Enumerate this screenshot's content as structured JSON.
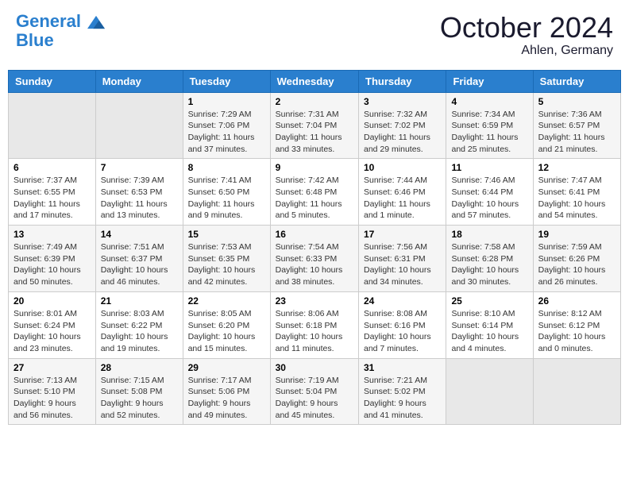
{
  "header": {
    "logo_line1": "General",
    "logo_line2": "Blue",
    "month": "October 2024",
    "location": "Ahlen, Germany"
  },
  "weekdays": [
    "Sunday",
    "Monday",
    "Tuesday",
    "Wednesday",
    "Thursday",
    "Friday",
    "Saturday"
  ],
  "weeks": [
    [
      {
        "day": "",
        "details": ""
      },
      {
        "day": "",
        "details": ""
      },
      {
        "day": "1",
        "details": "Sunrise: 7:29 AM\nSunset: 7:06 PM\nDaylight: 11 hours and 37 minutes."
      },
      {
        "day": "2",
        "details": "Sunrise: 7:31 AM\nSunset: 7:04 PM\nDaylight: 11 hours and 33 minutes."
      },
      {
        "day": "3",
        "details": "Sunrise: 7:32 AM\nSunset: 7:02 PM\nDaylight: 11 hours and 29 minutes."
      },
      {
        "day": "4",
        "details": "Sunrise: 7:34 AM\nSunset: 6:59 PM\nDaylight: 11 hours and 25 minutes."
      },
      {
        "day": "5",
        "details": "Sunrise: 7:36 AM\nSunset: 6:57 PM\nDaylight: 11 hours and 21 minutes."
      }
    ],
    [
      {
        "day": "6",
        "details": "Sunrise: 7:37 AM\nSunset: 6:55 PM\nDaylight: 11 hours and 17 minutes."
      },
      {
        "day": "7",
        "details": "Sunrise: 7:39 AM\nSunset: 6:53 PM\nDaylight: 11 hours and 13 minutes."
      },
      {
        "day": "8",
        "details": "Sunrise: 7:41 AM\nSunset: 6:50 PM\nDaylight: 11 hours and 9 minutes."
      },
      {
        "day": "9",
        "details": "Sunrise: 7:42 AM\nSunset: 6:48 PM\nDaylight: 11 hours and 5 minutes."
      },
      {
        "day": "10",
        "details": "Sunrise: 7:44 AM\nSunset: 6:46 PM\nDaylight: 11 hours and 1 minute."
      },
      {
        "day": "11",
        "details": "Sunrise: 7:46 AM\nSunset: 6:44 PM\nDaylight: 10 hours and 57 minutes."
      },
      {
        "day": "12",
        "details": "Sunrise: 7:47 AM\nSunset: 6:41 PM\nDaylight: 10 hours and 54 minutes."
      }
    ],
    [
      {
        "day": "13",
        "details": "Sunrise: 7:49 AM\nSunset: 6:39 PM\nDaylight: 10 hours and 50 minutes."
      },
      {
        "day": "14",
        "details": "Sunrise: 7:51 AM\nSunset: 6:37 PM\nDaylight: 10 hours and 46 minutes."
      },
      {
        "day": "15",
        "details": "Sunrise: 7:53 AM\nSunset: 6:35 PM\nDaylight: 10 hours and 42 minutes."
      },
      {
        "day": "16",
        "details": "Sunrise: 7:54 AM\nSunset: 6:33 PM\nDaylight: 10 hours and 38 minutes."
      },
      {
        "day": "17",
        "details": "Sunrise: 7:56 AM\nSunset: 6:31 PM\nDaylight: 10 hours and 34 minutes."
      },
      {
        "day": "18",
        "details": "Sunrise: 7:58 AM\nSunset: 6:28 PM\nDaylight: 10 hours and 30 minutes."
      },
      {
        "day": "19",
        "details": "Sunrise: 7:59 AM\nSunset: 6:26 PM\nDaylight: 10 hours and 26 minutes."
      }
    ],
    [
      {
        "day": "20",
        "details": "Sunrise: 8:01 AM\nSunset: 6:24 PM\nDaylight: 10 hours and 23 minutes."
      },
      {
        "day": "21",
        "details": "Sunrise: 8:03 AM\nSunset: 6:22 PM\nDaylight: 10 hours and 19 minutes."
      },
      {
        "day": "22",
        "details": "Sunrise: 8:05 AM\nSunset: 6:20 PM\nDaylight: 10 hours and 15 minutes."
      },
      {
        "day": "23",
        "details": "Sunrise: 8:06 AM\nSunset: 6:18 PM\nDaylight: 10 hours and 11 minutes."
      },
      {
        "day": "24",
        "details": "Sunrise: 8:08 AM\nSunset: 6:16 PM\nDaylight: 10 hours and 7 minutes."
      },
      {
        "day": "25",
        "details": "Sunrise: 8:10 AM\nSunset: 6:14 PM\nDaylight: 10 hours and 4 minutes."
      },
      {
        "day": "26",
        "details": "Sunrise: 8:12 AM\nSunset: 6:12 PM\nDaylight: 10 hours and 0 minutes."
      }
    ],
    [
      {
        "day": "27",
        "details": "Sunrise: 7:13 AM\nSunset: 5:10 PM\nDaylight: 9 hours and 56 minutes."
      },
      {
        "day": "28",
        "details": "Sunrise: 7:15 AM\nSunset: 5:08 PM\nDaylight: 9 hours and 52 minutes."
      },
      {
        "day": "29",
        "details": "Sunrise: 7:17 AM\nSunset: 5:06 PM\nDaylight: 9 hours and 49 minutes."
      },
      {
        "day": "30",
        "details": "Sunrise: 7:19 AM\nSunset: 5:04 PM\nDaylight: 9 hours and 45 minutes."
      },
      {
        "day": "31",
        "details": "Sunrise: 7:21 AM\nSunset: 5:02 PM\nDaylight: 9 hours and 41 minutes."
      },
      {
        "day": "",
        "details": ""
      },
      {
        "day": "",
        "details": ""
      }
    ]
  ]
}
